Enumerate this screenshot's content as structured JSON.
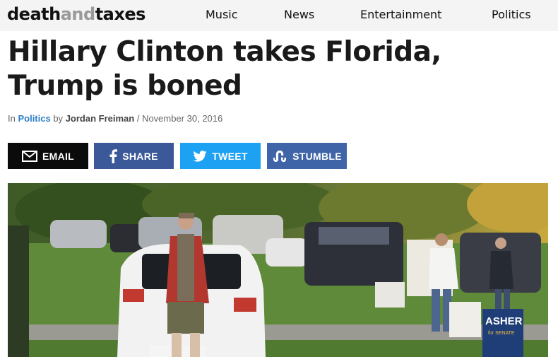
{
  "site": {
    "logo_part1": "death",
    "logo_part2": "and",
    "logo_part3": "taxes"
  },
  "nav": [
    "Music",
    "News",
    "Entertainment",
    "Politics"
  ],
  "article": {
    "headline_line1": "Hillary Clinton takes Florida,",
    "headline_line2": "Trump is boned",
    "byline_in": "In ",
    "category": "Politics",
    "byline_by": " by ",
    "author": "Jordan Freiman",
    "byline_sep": " / ",
    "date": "November 30, 2016"
  },
  "share": {
    "email_label": "EMAIL",
    "share_label": "SHARE",
    "tweet_label": "TWEET",
    "stumble_label": "STUMBLE"
  },
  "photo": {
    "sign_text_1": "ASHER",
    "sign_text_2": "for SENATE"
  },
  "colors": {
    "category_link": "#2c7fc4",
    "facebook": "#3b5998",
    "twitter": "#1da1f2",
    "stumble": "#3f64a8",
    "email": "#0b0b0b"
  },
  "icons": [
    "envelope-icon",
    "facebook-icon",
    "twitter-icon",
    "stumbleupon-icon"
  ]
}
